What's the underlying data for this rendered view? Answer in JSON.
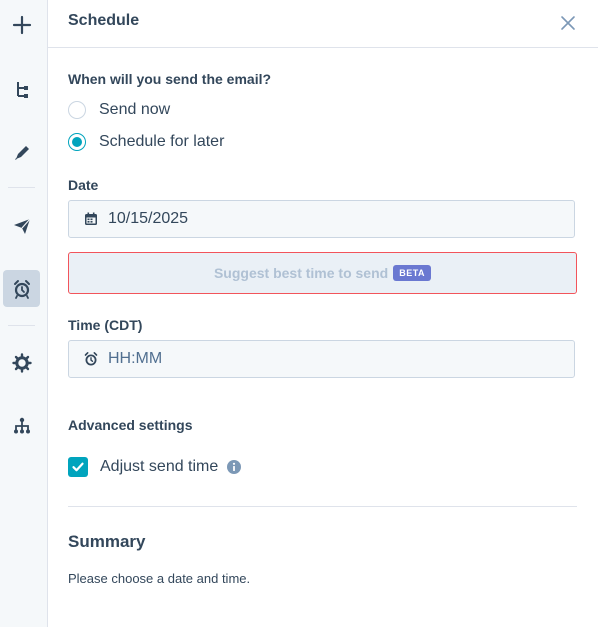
{
  "rail": {
    "items": [
      {
        "icon": "plus-icon"
      },
      {
        "icon": "tree-icon"
      },
      {
        "icon": "pencil-icon"
      },
      {
        "icon": "send-icon"
      },
      {
        "icon": "alarm-clock-icon",
        "active": true
      },
      {
        "icon": "gear-icon"
      },
      {
        "icon": "hierarchy-icon"
      }
    ]
  },
  "header": {
    "title": "Schedule",
    "close_icon": "close-icon"
  },
  "send_section": {
    "question": "When will you send the email?",
    "options": [
      {
        "label": "Send now",
        "selected": false
      },
      {
        "label": "Schedule for later",
        "selected": true
      }
    ]
  },
  "date": {
    "label": "Date",
    "value": "10/15/2025",
    "icon": "calendar-icon"
  },
  "suggest": {
    "label": "Suggest best time to send",
    "badge": "BETA"
  },
  "time": {
    "label": "Time (CDT)",
    "placeholder": "HH:MM",
    "icon": "alarm-clock-icon"
  },
  "advanced": {
    "label": "Advanced settings",
    "adjust_send_time": {
      "label": "Adjust send time",
      "checked": true,
      "info_icon": "info-icon"
    }
  },
  "summary": {
    "title": "Summary",
    "text": "Please choose a date and time."
  },
  "colors": {
    "accent": "#00a4bd",
    "text": "#33475b",
    "error_border": "#f2545b",
    "beta_badge": "#6a78d1",
    "rail_bg": "#f5f8fa"
  }
}
